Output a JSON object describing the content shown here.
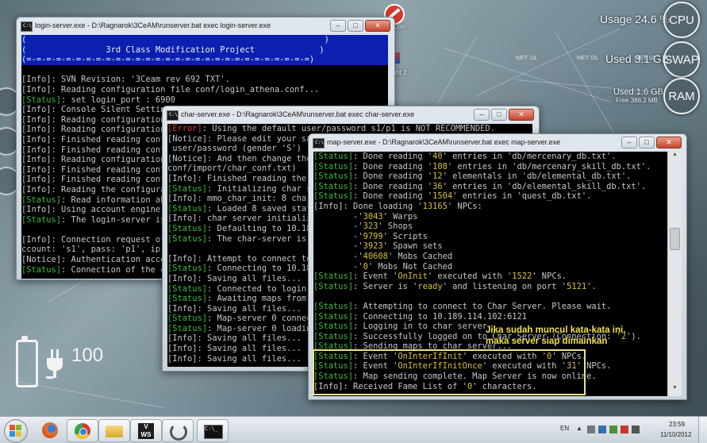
{
  "desktop": {
    "cpu_label": "CPU",
    "cpu_usage": "Usage 24.6 %",
    "swap_label": "SWAP",
    "swap_used": "Used 3.1 GB",
    "ram_label": "RAM",
    "ram_used": "Used 1.6 GB",
    "ram_free": "Free 386.2 MB",
    "net_labels": [
      "NET UL",
      "NET DL",
      "NET UL"
    ],
    "icon_labels": [
      "Con",
      "ight 2"
    ],
    "battery_value": "100"
  },
  "login_window": {
    "title": "login-server.exe - D:\\Ragnarok\\3CeAM\\runserver.bat   exec login-server.exe",
    "banner": [
      "(                                                            )",
      "(                3rd Class Modification Project             )",
      "(=-=-=-=-=-=-=-=-=-=-=-=-=-=-=-=-=-=-=-=-=-=-=-=-=-=-=-=-=)"
    ],
    "lines": [
      {
        "tag": "[Info]",
        "type": "info",
        "text": ": SVN Revision: '3Ceam rev 692 TXT'."
      },
      {
        "tag": "[Info]",
        "type": "info",
        "text": ": Reading configuration file conf/login_athena.conf..."
      },
      {
        "tag": "[Status]",
        "type": "status",
        "text": ": set login_port : 6900"
      },
      {
        "tag": "[Info]",
        "type": "info",
        "text": ": Console Silent Setting:"
      },
      {
        "tag": "[Info]",
        "type": "info",
        "text": ": Reading configuration fi"
      },
      {
        "tag": "[Info]",
        "type": "info",
        "text": ": Reading configuration fi"
      },
      {
        "tag": "[Info]",
        "type": "info",
        "text": ": Finished reading conf/im"
      },
      {
        "tag": "[Info]",
        "type": "info",
        "text": ": Finished reading conf/im"
      },
      {
        "tag": "[Info]",
        "type": "info",
        "text": ": Reading configuration fi"
      },
      {
        "tag": "[Info]",
        "type": "info",
        "text": ": Finished reading conf/lo"
      },
      {
        "tag": "[Info]",
        "type": "info",
        "text": ": Finished reading conf/lo"
      },
      {
        "tag": "[Info]",
        "type": "info",
        "text": ": Reading the configuration"
      },
      {
        "tag": "[Status]",
        "type": "status",
        "text": ": Read information about"
      },
      {
        "tag": "[Info]",
        "type": "info",
        "text": ": Using account engine 'tx"
      },
      {
        "tag": "[Status]",
        "type": "status",
        "text": ": The login-server is rea"
      },
      {
        "tag": "",
        "type": "info",
        "text": ""
      },
      {
        "tag": "[Info]",
        "type": "info",
        "text": ": Connection request of the"
      },
      {
        "tag": "",
        "type": "info",
        "text": "ccount: 's1', pass: 'p1', ip: '10"
      },
      {
        "tag": "[Notice]",
        "type": "notice",
        "text": ": Authentication accepted"
      },
      {
        "tag": "[Status]",
        "type": "status",
        "text": ": Connection of the char"
      }
    ]
  },
  "char_window": {
    "title": "char-server.exe - D:\\Ragnarok\\3CeAM\\runserver.bat   exec char-server.exe",
    "lines": [
      {
        "tag": "[Error]",
        "type": "error",
        "text": ": Using the default user/password s1/p1 is NOT RECOMMENDED."
      },
      {
        "tag": "[Notice]",
        "type": "notice",
        "text": ": Please edit your save/"
      },
      {
        "tag": "",
        "type": "info",
        "text": " user/password (gender 'S')"
      },
      {
        "tag": "[Notice]",
        "type": "notice",
        "text": ": And then change the us"
      },
      {
        "tag": "",
        "type": "info",
        "text": "conf/import/char_conf.txt)"
      },
      {
        "tag": "[Info]",
        "type": "info",
        "text": ": Finished reading the cha"
      },
      {
        "tag": "[Status]",
        "type": "status",
        "text": ": Initializing char server"
      },
      {
        "tag": "[Info]",
        "type": "info",
        "text": ": mmo_char_init: 8 chara"
      },
      {
        "tag": "[Status]",
        "type": "status",
        "text": ": Loaded 8 saved status"
      },
      {
        "tag": "[Info]",
        "type": "info",
        "text": ": char server initialized."
      },
      {
        "tag": "[Status]",
        "type": "status",
        "text": ": Defaulting to 10.189.1"
      },
      {
        "tag": "[Status]",
        "type": "status",
        "text": ": The char-server is rea"
      },
      {
        "tag": "",
        "type": "info",
        "text": ""
      },
      {
        "tag": "[Info]",
        "type": "info",
        "text": ": Attempt to connect to lo"
      },
      {
        "tag": "[Status]",
        "type": "status",
        "text": ": Connecting to 10.189.1"
      },
      {
        "tag": "[Info]",
        "type": "info",
        "text": ": Saving all files..."
      },
      {
        "tag": "[Status]",
        "type": "status",
        "text": ": Connected to login-ser"
      },
      {
        "tag": "[Status]",
        "type": "status",
        "text": ": Awaiting maps from map"
      },
      {
        "tag": "[Info]",
        "type": "info",
        "text": ": Saving all files..."
      },
      {
        "tag": "[Status]",
        "type": "status",
        "text": ": Map-server 0 connected"
      },
      {
        "tag": "[Status]",
        "type": "status",
        "text": ": Map-server 0 loading c"
      },
      {
        "tag": "[Info]",
        "type": "info",
        "text": ": Saving all files..."
      },
      {
        "tag": "[Info]",
        "type": "info",
        "text": ": Saving all files..."
      },
      {
        "tag": "[Info]",
        "type": "info",
        "text": ": Saving all files..."
      }
    ]
  },
  "map_window": {
    "title": "map-server.exe - D:\\Ragnarok\\3CeAM\\runserver.bat   exec map-server.exe",
    "lines": [
      {
        "tag": "[Status]",
        "type": "status",
        "segments": [
          ": Done reading '",
          "40",
          "' entries in 'db/mercenary_db.txt'."
        ]
      },
      {
        "tag": "[Status]",
        "type": "status",
        "segments": [
          ": Done reading '",
          "108",
          "' entries in 'db/mercenary_skill_db.txt'."
        ]
      },
      {
        "tag": "[Status]",
        "type": "status",
        "segments": [
          ": Done reading '",
          "12",
          "' elementals in 'db/elemental_db.txt'."
        ]
      },
      {
        "tag": "[Status]",
        "type": "status",
        "segments": [
          ": Done reading '",
          "36",
          "' entries in 'db/elemental_skill_db.txt'."
        ]
      },
      {
        "tag": "[Status]",
        "type": "status",
        "segments": [
          ": Done reading '",
          "1504",
          "' entries in 'quest_db.txt'."
        ]
      },
      {
        "tag": "[Info]",
        "type": "info",
        "segments": [
          ": Done loading '",
          "13165",
          "' NPCs:"
        ]
      },
      {
        "tag": "",
        "type": "info",
        "segments": [
          "        -'",
          "3043",
          "' Warps"
        ]
      },
      {
        "tag": "",
        "type": "info",
        "segments": [
          "        -'",
          "323",
          "' Shops"
        ]
      },
      {
        "tag": "",
        "type": "info",
        "segments": [
          "        -'",
          "9799",
          "' Scripts"
        ]
      },
      {
        "tag": "",
        "type": "info",
        "segments": [
          "        -'",
          "3923",
          "' Spawn sets"
        ]
      },
      {
        "tag": "",
        "type": "info",
        "segments": [
          "        -'",
          "40608",
          "' Mobs Cached"
        ]
      },
      {
        "tag": "",
        "type": "info",
        "segments": [
          "        -'",
          "0",
          "' Mobs Not Cached"
        ]
      },
      {
        "tag": "[Status]",
        "type": "status",
        "segments": [
          ": Event '",
          "OnInit",
          "' executed with '",
          "1522",
          "' NPCs."
        ]
      },
      {
        "tag": "[Status]",
        "type": "status",
        "segments": [
          ": Server is '",
          "ready",
          "' and listening on port '",
          "5121",
          "'."
        ]
      },
      {
        "tag": "",
        "type": "info",
        "segments": [
          ""
        ]
      },
      {
        "tag": "[Status]",
        "type": "status",
        "segments": [
          ": Attempting to connect to Char Server. Please wait."
        ]
      },
      {
        "tag": "[Status]",
        "type": "status",
        "segments": [
          ": Connecting to 10.189.114.102:6121"
        ]
      },
      {
        "tag": "[Status]",
        "type": "status",
        "segments": [
          ": Logging in to char server..."
        ]
      },
      {
        "tag": "[Status]",
        "type": "status",
        "segments": [
          ": Successfully logged on to Char Server (Connection: '",
          "2",
          "')."
        ]
      },
      {
        "tag": "[Status]",
        "type": "status",
        "segments": [
          ": Sending maps to char server..."
        ]
      },
      {
        "tag": "[Status]",
        "type": "status",
        "segments": [
          ": Event '",
          "OnInterIfInit",
          "' executed with '",
          "0",
          "' NPCs."
        ]
      },
      {
        "tag": "[Status]",
        "type": "status",
        "segments": [
          ": Event '",
          "OnInterIfInitOnce",
          "' executed with '",
          "31",
          "' NPCs."
        ]
      },
      {
        "tag": "[Status]",
        "type": "status",
        "segments": [
          ": Map sending complete. Map Server is now online."
        ]
      },
      {
        "tag": "[Info]",
        "type": "info",
        "segments": [
          ": Received Fame List of '",
          "0",
          "' characters."
        ]
      }
    ]
  },
  "annotation": {
    "line1": "Jika sudah muncul kata-kata ini,",
    "line2": "maka server siap dimainkan"
  },
  "taskbar": {
    "language": "EN",
    "time": "23:59",
    "date": "11/10/2012"
  },
  "colors": {
    "status": "#3bbf3b",
    "error": "#d24040",
    "quoted": "#d8c23c",
    "banner": "#0b1fb0",
    "highlight_box": "#ece38a"
  }
}
